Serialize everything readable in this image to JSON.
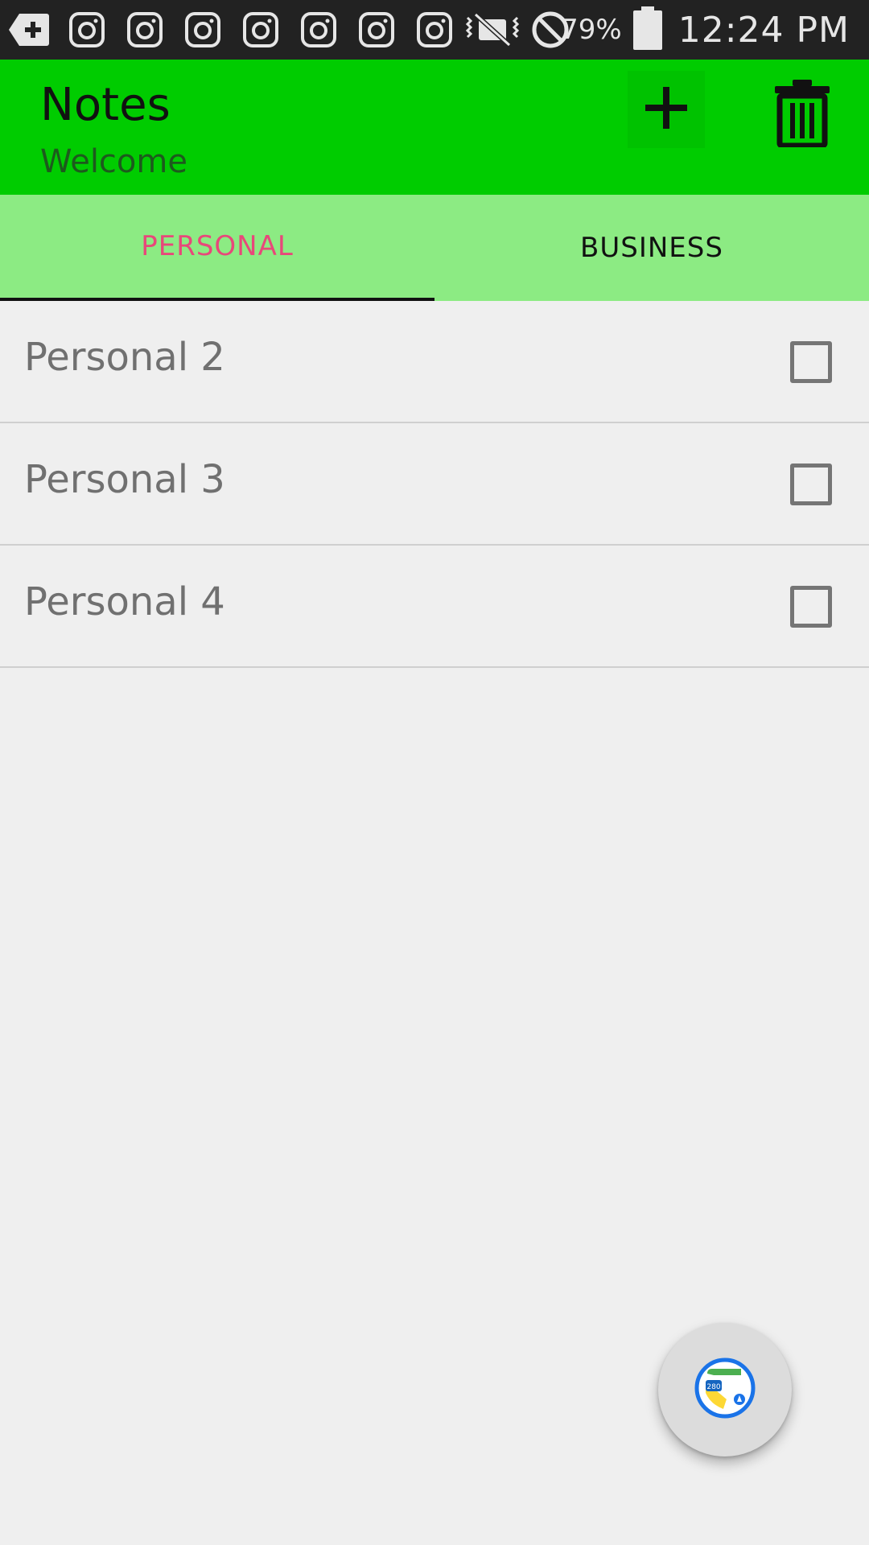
{
  "status_bar": {
    "icons": [
      "add-box-icon",
      "instagram-icon",
      "instagram-icon",
      "instagram-icon",
      "instagram-icon",
      "instagram-icon",
      "instagram-icon",
      "instagram-icon",
      "vibrate-mute-icon",
      "do-not-disturb-icon",
      "battery-icon"
    ],
    "battery_percent": "79%",
    "time": "12:24 PM"
  },
  "app_bar": {
    "title": "Notes",
    "subtitle": "Welcome",
    "color": "#00cc00",
    "actions": [
      "add-icon",
      "trash-icon"
    ]
  },
  "tabs": [
    {
      "label": "PERSONAL",
      "selected": true,
      "color": "#e8487a"
    },
    {
      "label": "BUSINESS",
      "selected": false,
      "color": "#111111"
    }
  ],
  "notes": [
    {
      "label": "Personal 2",
      "checked": false
    },
    {
      "label": "Personal 3",
      "checked": false
    },
    {
      "label": "Personal 4",
      "checked": false
    }
  ],
  "fab": {
    "icon": "maps-app-icon"
  }
}
